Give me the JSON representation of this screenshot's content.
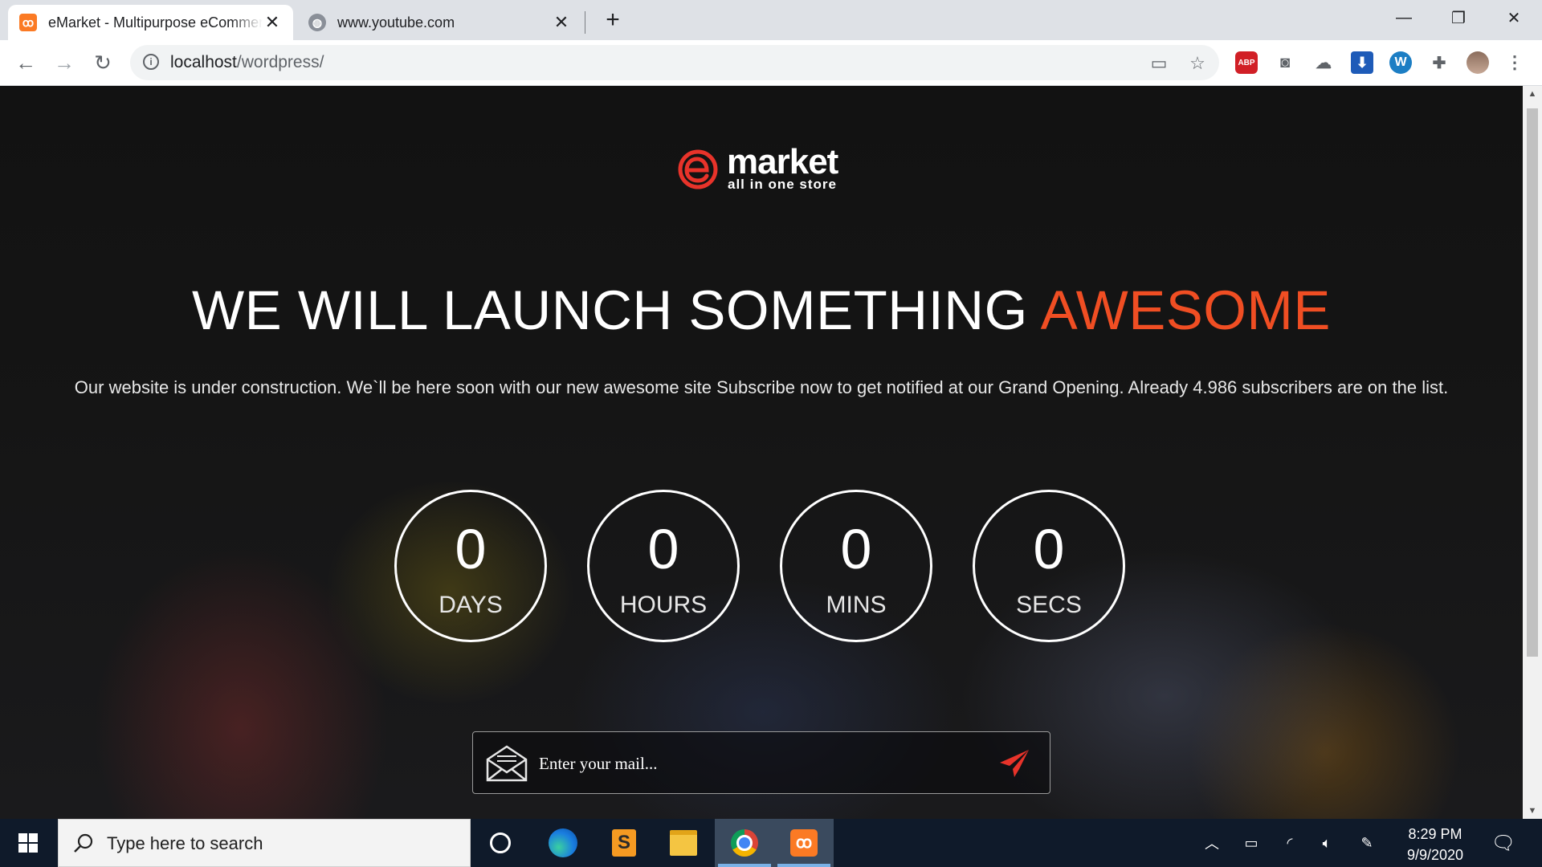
{
  "browser": {
    "tabs": [
      {
        "title": "eMarket - Multipurpose eCommerce",
        "active": true,
        "favicon": "xampp-icon"
      },
      {
        "title": "www.youtube.com",
        "active": false,
        "favicon": "globe-icon"
      }
    ],
    "url_host": "localhost",
    "url_path": "/wordpress/",
    "extensions": [
      "cast-icon",
      "bookmark-star-icon",
      "adblock-icon",
      "camera-icon",
      "cloud-sync-icon",
      "download-icon",
      "wordpress-icon",
      "extensions-puzzle-icon",
      "profile-avatar",
      "menu-dots-icon"
    ]
  },
  "page": {
    "logo": {
      "name": "market",
      "tagline": "all in one store"
    },
    "headline": "WE WILL LAUNCH SOMETHING",
    "headline_accent": "AWESOME",
    "subtitle": "Our website is under construction. We`ll be here soon with our new awesome site Subscribe now to get notified at our Grand Opening. Already 4.986 subscribers are on the list.",
    "countdown": [
      {
        "value": "0",
        "label": "DAYS"
      },
      {
        "value": "0",
        "label": "HOURS"
      },
      {
        "value": "0",
        "label": "MINS"
      },
      {
        "value": "0",
        "label": "SECS"
      }
    ],
    "subscribe": {
      "placeholder": "Enter your mail...",
      "value": ""
    }
  },
  "taskbar": {
    "search_placeholder": "Type here to search",
    "apps": [
      "cortana-icon",
      "edge-icon",
      "sublime-icon",
      "file-explorer-icon",
      "chrome-icon",
      "xampp-icon"
    ],
    "time": "8:29 PM",
    "date": "9/9/2020"
  },
  "colors": {
    "accent": "#f04e23",
    "page_bg": "#141414",
    "taskbar": "#0f1a2a",
    "tabstrip": "#dee1e6"
  }
}
